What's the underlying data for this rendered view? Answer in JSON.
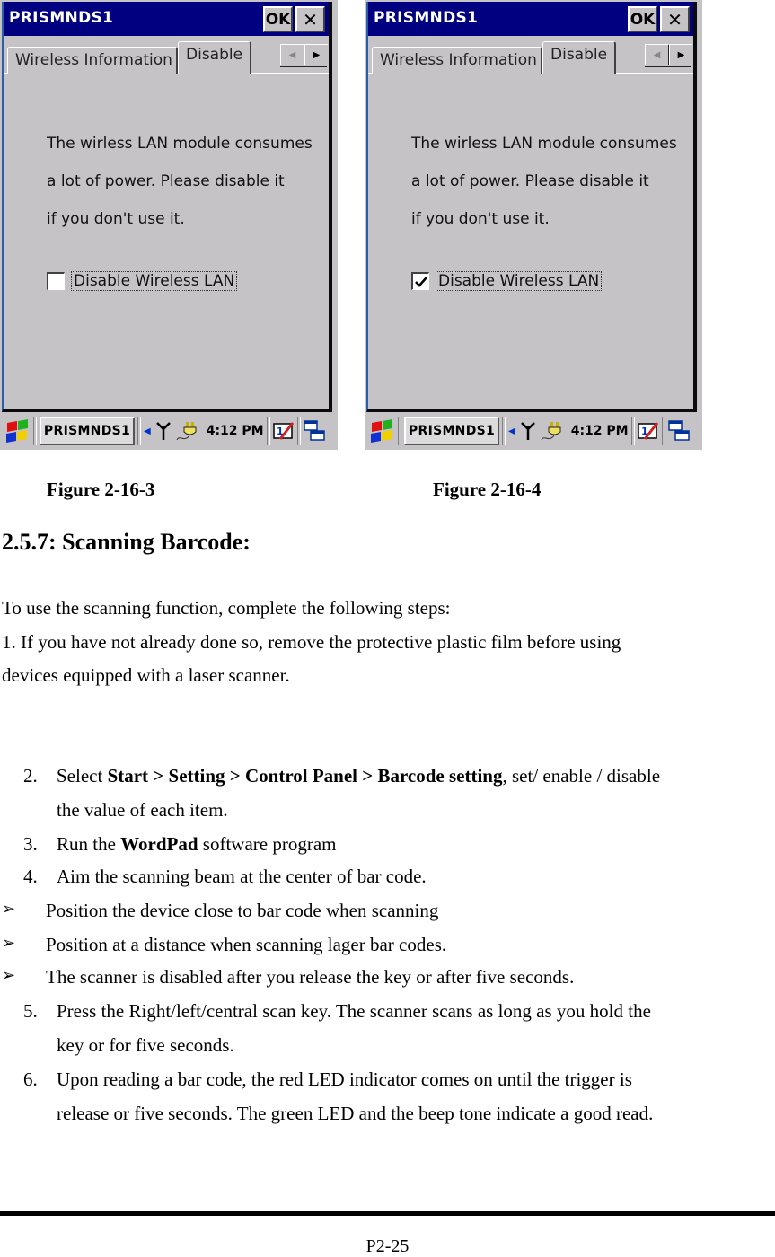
{
  "screens": [
    {
      "window_title": "PRISMNDS1",
      "ok_label": "OK",
      "close_label": "✕",
      "tabs": [
        {
          "label": "Wireless Information",
          "active": false
        },
        {
          "label": "Disable",
          "active": true
        }
      ],
      "message_lines": [
        "The wirless LAN module consumes",
        "a lot of power. Please disable it",
        "if you don't use it."
      ],
      "checkbox_label": "Disable Wireless LAN",
      "checkbox_checked": false,
      "taskbar": {
        "task_label": "PRISMNDS1",
        "clock": "4:12 PM"
      }
    },
    {
      "window_title": "PRISMNDS1",
      "ok_label": "OK",
      "close_label": "✕",
      "tabs": [
        {
          "label": "Wireless Information",
          "active": false
        },
        {
          "label": "Disable",
          "active": true
        }
      ],
      "message_lines": [
        "The wirless LAN module consumes",
        "a lot of power. Please disable it",
        "if you don't use it."
      ],
      "checkbox_label": "Disable Wireless LAN",
      "checkbox_checked": true,
      "taskbar": {
        "task_label": "PRISMNDS1",
        "clock": "4:12 PM"
      }
    }
  ],
  "captions": [
    "Figure 2-16-3",
    "Figure 2-16-4"
  ],
  "section_heading": "2.5.7: Scanning Barcode:",
  "intro": "To use the scanning function, complete the following steps:",
  "step1_line1": "1. If you have not already done so, remove the protective plastic film before using",
  "step1_line2": "devices equipped with a laser scanner.",
  "steps": {
    "s2": {
      "num": "2.",
      "pre": "Select ",
      "bold1": "Start > Setting > Control Panel > Barcode setting",
      "post": ", set/ enable / disable",
      "line2": "the value of each item."
    },
    "s3": {
      "num": "3.",
      "pre": "Run the ",
      "bold": "WordPad",
      "post": " software program"
    },
    "s4": {
      "num": "4.",
      "text": "Aim the scanning beam at the center of bar code."
    },
    "bullets": [
      "Position the device close to bar code when scanning",
      "Position at a distance when scanning lager bar codes.",
      "The scanner is disabled after you release the key or after five seconds."
    ],
    "s5": {
      "num": "5.",
      "line1": "Press the Right/left/central scan key. The scanner scans as long as you hold the",
      "line2": "key or for five seconds."
    },
    "s6": {
      "num": "6.",
      "line1": "Upon reading a bar code, the red LED indicator comes on until the trigger is",
      "line2": "release or five seconds. The green LED and the beep tone indicate a good read."
    }
  },
  "bullet_glyph": "➢",
  "page_number": "P2-25",
  "colors": {
    "titlebar": "#000080",
    "window_bg": "#c6c3c6"
  }
}
